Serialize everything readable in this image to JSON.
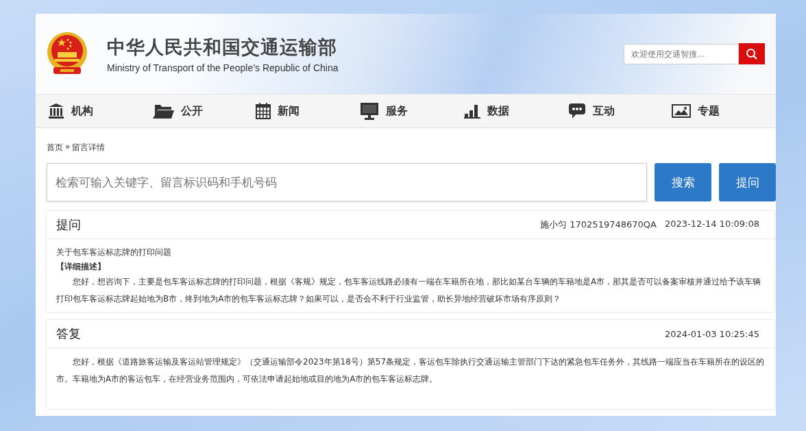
{
  "header": {
    "title": "中华人民共和国交通运输部",
    "subtitle": "Ministry of Transport of the People’s Republic of China",
    "search": {
      "placeholder": "欢迎使用交通智搜..."
    }
  },
  "nav": [
    {
      "label": "机构",
      "kind": "building"
    },
    {
      "label": "公开",
      "kind": "folder"
    },
    {
      "label": "新闻",
      "kind": "calendar"
    },
    {
      "label": "服务",
      "kind": "monitor"
    },
    {
      "label": "数据",
      "kind": "chart"
    },
    {
      "label": "互动",
      "kind": "chat"
    },
    {
      "label": "专题",
      "kind": "picture"
    }
  ],
  "breadcrumb": [
    "首页",
    "»",
    "留言详情"
  ],
  "query": {
    "placeholder": "检索可输入关键字、留言标识码和手机号码",
    "buttons": [
      "搜索",
      "提问"
    ]
  },
  "question": {
    "heading": "提问",
    "author": "施小匀 1702519748670QA",
    "time": "2023-12-14 10:09:08",
    "subject": "关于包车客运标志牌的打印问题",
    "label": "【详细描述】",
    "body": "您好，想咨询下，主要是包车客运标志牌的打印问题，根据《客规》规定，包车客运线路必须有一端在车籍所在地，那比如某台车辆的车籍地是A市，那其是否可以备案审核并通过给予该车辆打印包车客运标志牌起始地为B市，终到地为A市的包车客运标志牌？如果可以，是否会不利于行业监管，助长异地经营破坏市场有序原则？"
  },
  "answer": {
    "heading": "答复",
    "time": "2024-01-03 10:25:45",
    "body": "您好，根据《道路旅客运输及客运站管理规定》（交通运输部令2023年第18号）第57条规定，客运包车除执行交通运输主管部门下达的紧急包车任务外，其线路一端应当在车籍所在的设区的市。车籍地为A市的客运包车，在经营业务范围内，可依法申请起始地或目的地为A市的包车客运标志牌。"
  }
}
